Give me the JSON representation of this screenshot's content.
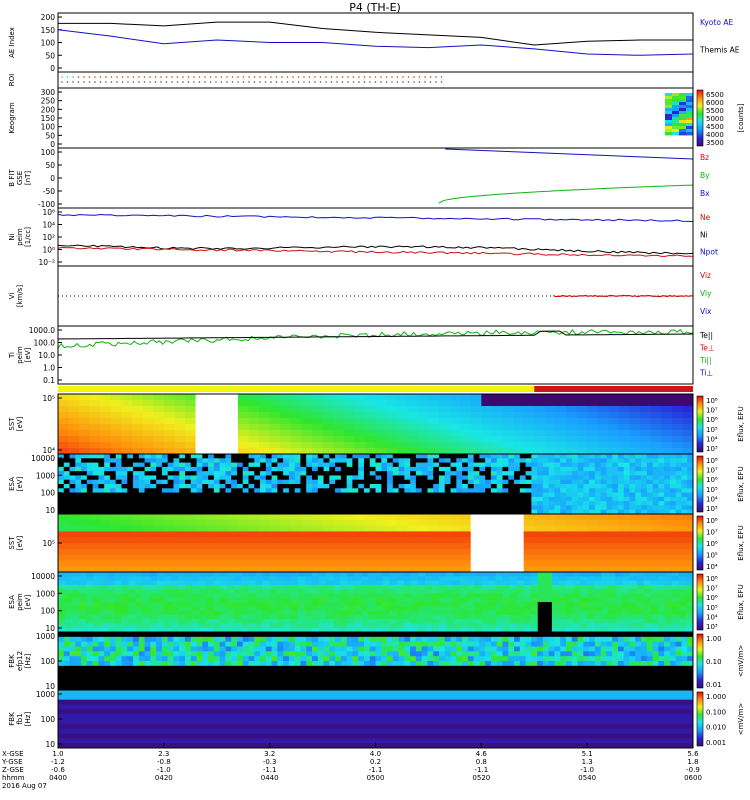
{
  "title": "P4 (TH-E)",
  "colors": {
    "blue": "#1010c8",
    "black": "#000000",
    "red": "#c81010",
    "green": "#10b010",
    "kyoto": "#1010c8",
    "themis": "#000000"
  },
  "panels": [
    {
      "id": "ae",
      "ylabel": "AE Index",
      "yticks": [
        "200",
        "150",
        "100",
        "50",
        "0"
      ],
      "legend": [
        {
          "text": "Kyoto AE",
          "color": "#1010c8"
        },
        {
          "text": "Themis AE",
          "color": "#000000"
        }
      ]
    },
    {
      "id": "roi",
      "ylabel": "ROI",
      "yticks": [],
      "legend": []
    },
    {
      "id": "keogram",
      "ylabel": "Keogram",
      "yticks": [
        "300",
        "250",
        "200",
        "150",
        "100",
        "50",
        "0"
      ],
      "colorbar": {
        "ticks": [
          "6500",
          "6000",
          "5500",
          "5000",
          "4500",
          "4000",
          "3500"
        ],
        "label": "[counts]"
      }
    },
    {
      "id": "bfit",
      "ylabel": "B FIT\nGSE\n[nT]",
      "yticks": [
        "100",
        "50",
        "0",
        "-50",
        "-100"
      ],
      "legend": [
        {
          "text": "Bz",
          "color": "#c81010"
        },
        {
          "text": "By",
          "color": "#10b010"
        },
        {
          "text": "Bx",
          "color": "#1010c8"
        }
      ]
    },
    {
      "id": "ni",
      "ylabel": "Ni\npeim\n[1/cc]",
      "yticks": [
        "10⁶",
        "10⁴",
        "10²",
        "10⁰",
        "10⁻²"
      ],
      "legend": [
        {
          "text": "Ne",
          "color": "#c81010"
        },
        {
          "text": "Ni",
          "color": "#000000"
        },
        {
          "text": "Npot",
          "color": "#1010c8"
        }
      ]
    },
    {
      "id": "vi",
      "ylabel": "Vi\n[km/s]",
      "yticks": [],
      "legend": [
        {
          "text": "Viz",
          "color": "#c81010"
        },
        {
          "text": "Viy",
          "color": "#10b010"
        },
        {
          "text": "Vix",
          "color": "#1010c8"
        }
      ]
    },
    {
      "id": "ti",
      "ylabel": "Ti\npeim\n[eV]",
      "yticks": [
        "1000.0",
        "100.0",
        "10.0",
        "1.0",
        "0.1"
      ],
      "legend": [
        {
          "text": "Te||",
          "color": "#000000"
        },
        {
          "text": "Te⊥",
          "color": "#c81010"
        },
        {
          "text": "Ti||",
          "color": "#10b010"
        },
        {
          "text": "Ti⊥",
          "color": "#1010c8"
        }
      ]
    },
    {
      "id": "sst1",
      "ylabel": "SST\n[eV]",
      "yticks": [
        "10⁵",
        "10⁴"
      ],
      "colorbar": {
        "ticks": [
          "10⁸",
          "10⁷",
          "10⁶",
          "10⁵",
          "10⁴",
          "10³"
        ],
        "label": "Eflux, EFU"
      }
    },
    {
      "id": "esa1",
      "ylabel": "ESA\n[eV]",
      "yticks": [
        "10000",
        "1000",
        "100",
        "10"
      ],
      "colorbar": {
        "ticks": [
          "10⁸",
          "10⁷",
          "10⁶",
          "10⁵",
          "10⁴",
          "10³"
        ],
        "label": "Eflux, EFU"
      }
    },
    {
      "id": "sst2",
      "ylabel": "SST\n[eV]",
      "yticks": [
        "10⁵"
      ],
      "colorbar": {
        "ticks": [
          "10⁸",
          "10⁷",
          "10⁶",
          "10⁵",
          "10⁴"
        ],
        "label": "Eflux, EFU"
      }
    },
    {
      "id": "esa2",
      "ylabel": "ESA\npeim\n[eV]",
      "yticks": [
        "10000",
        "1000",
        "100",
        "10"
      ],
      "colorbar": {
        "ticks": [
          "10⁸",
          "10⁷",
          "10⁶",
          "10⁵",
          "10⁴",
          "10³"
        ],
        "label": "Eflux, EFU"
      }
    },
    {
      "id": "fbk1",
      "ylabel": "FBK\nefp12\n[Hz]",
      "yticks": [
        "1000",
        "100",
        "10"
      ],
      "colorbar": {
        "ticks": [
          "1.00",
          "0.10",
          "0.01"
        ],
        "label": "<mV/m>"
      }
    },
    {
      "id": "fbk2",
      "ylabel": "FBK\nfb1\n[Hz]",
      "yticks": [
        "1000",
        "100",
        "10"
      ],
      "colorbar": {
        "ticks": [
          "1.000",
          "0.100",
          "0.010",
          "0.001"
        ],
        "label": "<mV/m>"
      }
    }
  ],
  "x_axis": {
    "row_labels": [
      "X-GSE",
      "Y-GSE",
      "Z-GSE",
      "hhmm",
      "2016 Aug 07"
    ],
    "columns": [
      {
        "x": "1.0",
        "y": "-1.2",
        "z": "-0.6",
        "t": "0400"
      },
      {
        "x": "2.3",
        "y": "-0.8",
        "z": "-1.0",
        "t": "0420"
      },
      {
        "x": "3.2",
        "y": "-0.3",
        "z": "-1.1",
        "t": "0440"
      },
      {
        "x": "4.0",
        "y": "0.2",
        "z": "-1.1",
        "t": "0500"
      },
      {
        "x": "4.6",
        "y": "0.8",
        "z": "-1.1",
        "t": "0520"
      },
      {
        "x": "5.1",
        "y": "1.3",
        "z": "-1.0",
        "t": "0540"
      },
      {
        "x": "5.6",
        "y": "1.8",
        "z": "-0.9",
        "t": "0600"
      }
    ]
  },
  "chart_data": {
    "type": "line",
    "title": "P4 (TH-E)",
    "x": [
      "0400",
      "0410",
      "0420",
      "0430",
      "0440",
      "0450",
      "0500",
      "0510",
      "0520",
      "0530",
      "0540",
      "0550",
      "0600"
    ],
    "series": [
      {
        "name": "Kyoto AE",
        "values": [
          150,
          125,
          95,
          110,
          100,
          100,
          85,
          80,
          90,
          75,
          55,
          50,
          55
        ]
      },
      {
        "name": "Themis AE",
        "values": [
          175,
          175,
          165,
          180,
          180,
          155,
          140,
          130,
          120,
          90,
          105,
          110,
          110
        ]
      }
    ],
    "ylabel": "AE Index",
    "ylim": [
      0,
      200
    ]
  }
}
